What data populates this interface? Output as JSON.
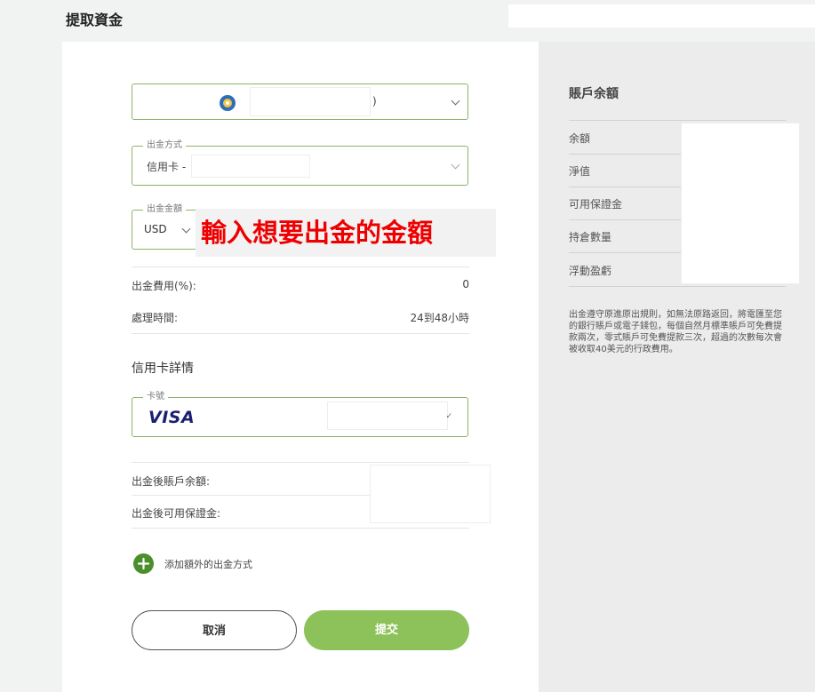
{
  "page": {
    "title": "提取資金"
  },
  "account_select": {
    "suffix": ")"
  },
  "withdraw_method": {
    "legend": "出金方式",
    "value": "信用卡 -"
  },
  "withdraw_amount": {
    "legend": "出金金額",
    "currency": "USD",
    "hint": "輸入想要出金的金額"
  },
  "fees": [
    {
      "label": "出金費用(%):",
      "value": "0"
    },
    {
      "label": "處理時間:",
      "value": "24到48小時"
    }
  ],
  "card_details": {
    "heading": "信用卡詳情",
    "card_legend": "卡號",
    "brand": "VISA"
  },
  "after_withdraw": [
    {
      "label": "出金後賬戶余額:"
    },
    {
      "label": "出金後可用保證金:"
    }
  ],
  "add_method": {
    "label": "添加額外的出金方式"
  },
  "buttons": {
    "cancel": "取消",
    "submit": "提交"
  },
  "account_balance": {
    "title": "賬戶余額",
    "rows": [
      "余額",
      "淨值",
      "可用保證金",
      "持倉數量",
      "浮動盈虧"
    ],
    "note": "出金遵守原進原出規則，如無法原路返回，將電匯至您的銀行賬戶或電子錢包，每個自然月標準賬戶可免費提款兩次，零式賬戶可免費提款三次，超過的次數每次會被收取40美元的行政費用。"
  },
  "colors": {
    "accent": "#8dc15a",
    "border": "#8bb466",
    "hint": "#e00000"
  }
}
